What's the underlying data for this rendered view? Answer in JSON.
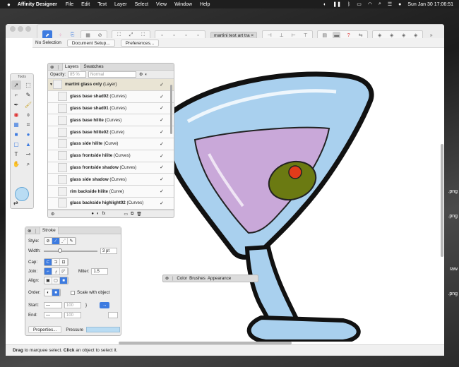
{
  "menubar": {
    "app_name": "Affinity Designer",
    "items": [
      "File",
      "Edit",
      "Text",
      "Layer",
      "Select",
      "View",
      "Window",
      "Help"
    ],
    "clock": "Sun Jan 30  17:06:51"
  },
  "toolbar": {
    "doc_tab": "martini test art tra",
    "doc_tab_close": "×",
    "overflow": "»"
  },
  "context_bar": {
    "selection": "No Selection",
    "document_setup": "Document Setup...",
    "preferences": "Preferences..."
  },
  "tools_panel": {
    "title": "Tools",
    "tools": [
      "move",
      "node",
      "corner",
      "pencil",
      "pen",
      "brush",
      "fill",
      "gradient",
      "transparency",
      "crop",
      "rectangle",
      "ellipse",
      "rounded-rect",
      "triangle",
      "text",
      "eyedropper",
      "hand",
      "zoom"
    ]
  },
  "layers_panel": {
    "tabs": [
      "Layers",
      "Swatches"
    ],
    "opacity_label": "Opacity:",
    "opacity_value": "85 %",
    "blend_mode": "Normal",
    "layers": [
      {
        "name": "martini glass ovly",
        "type": "(Layer)",
        "parent": true
      },
      {
        "name": "glass base shad02",
        "type": "(Curves)"
      },
      {
        "name": "glass base shad01",
        "type": "(Curves)"
      },
      {
        "name": "glass base hilite",
        "type": "(Curves)"
      },
      {
        "name": "glass base hilite02",
        "type": "(Curve)"
      },
      {
        "name": "glass side hilite",
        "type": "(Curve)"
      },
      {
        "name": "glass frontside hilite",
        "type": "(Curves)"
      },
      {
        "name": "glass frontside shadow",
        "type": "(Curves)"
      },
      {
        "name": "glass side shadow",
        "type": "(Curves)"
      },
      {
        "name": "rim backside hilite",
        "type": "(Curve)"
      },
      {
        "name": "glass backside highlight02",
        "type": "(Curves)"
      }
    ]
  },
  "stroke_panel": {
    "tab": "Stroke",
    "style_label": "Style:",
    "width_label": "Width:",
    "width_value": "3 pt",
    "width_fraction": 0.3,
    "cap_label": "Cap:",
    "join_label": "Join:",
    "miter_label": "Miter:",
    "miter_value": "1.5",
    "align_label": "Align:",
    "order_label": "Order:",
    "scale_with_object": "Scale with object",
    "start_label": "Start:",
    "end_label": "End:",
    "start_value": "100",
    "end_value": "100",
    "properties_btn": "Properties...",
    "pressure_label": "Pressure"
  },
  "color_panel": {
    "tabs": [
      "Color",
      "Brushes",
      "Appearance"
    ]
  },
  "status_bar": {
    "parts": [
      {
        "text": "Drag",
        "bold": true
      },
      {
        "text": " to marquee select. ",
        "bold": false
      },
      {
        "text": "Click",
        "bold": true
      },
      {
        "text": " an object to select it.",
        "bold": false
      }
    ]
  },
  "desktop_labels": [
    ".png",
    ".png",
    "raw",
    ".png"
  ],
  "colors": {
    "accent": "#3d7be0",
    "liquid": "#c9a8d9",
    "glass": "#a9d0ee",
    "olive": "#6b7a12"
  }
}
